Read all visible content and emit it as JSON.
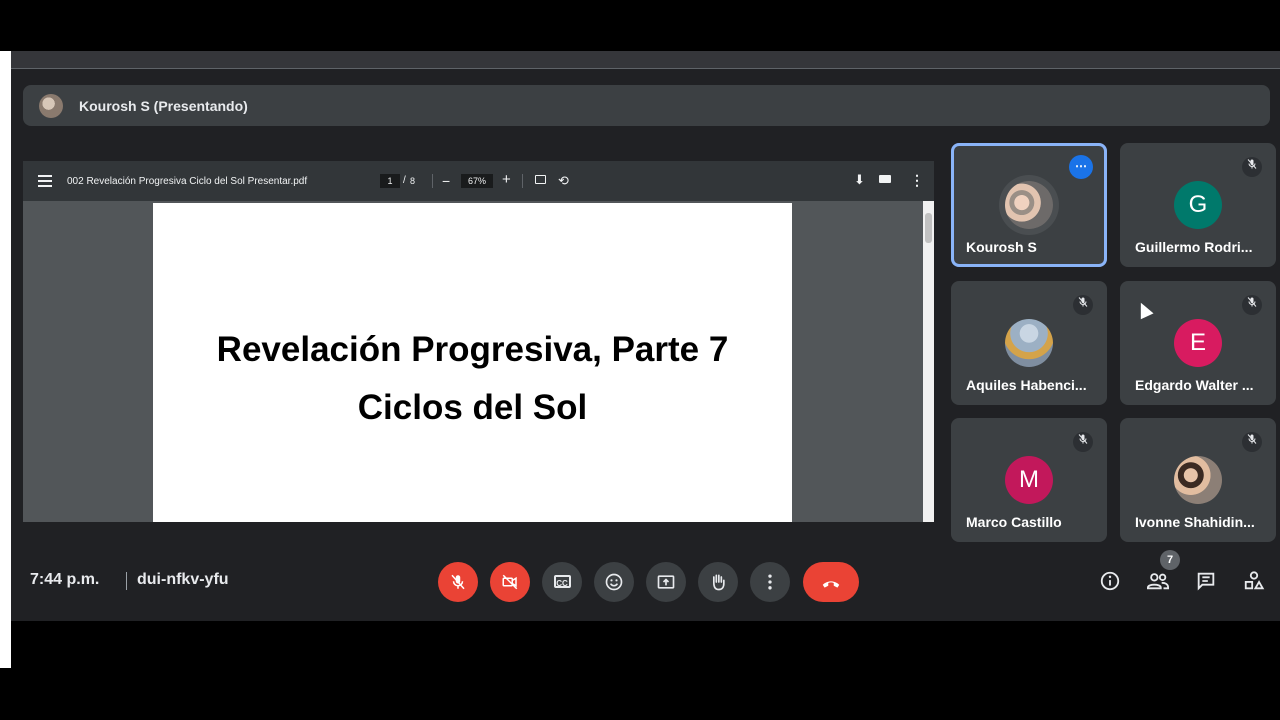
{
  "presenter": {
    "name": "Kourosh S (Presentando)"
  },
  "pdf_viewer": {
    "filename": "002 Revelación Progresiva Ciclo del Sol Presentar.pdf",
    "page_current": "1",
    "page_separator": "/",
    "page_total": "8",
    "zoom": "67%",
    "zoom_out_glyph": "−",
    "zoom_in_glyph": "+",
    "rotate_glyph": "⟲",
    "download_glyph": "⬇",
    "more_glyph": "⋮",
    "slide": {
      "line1": "Revelación Progresiva, Parte 7",
      "line2": "Ciclos del Sol"
    }
  },
  "participants": [
    {
      "name": "Kourosh S",
      "avatar_type": "photo",
      "active": true
    },
    {
      "name": "Guillermo Rodri...",
      "initial": "G",
      "color": "#00796b",
      "muted": true
    },
    {
      "name": "Aquiles Habenci...",
      "avatar_type": "photo",
      "muted": true
    },
    {
      "name": "Edgardo Walter ...",
      "initial": "E",
      "color": "#d81b60",
      "muted": true
    },
    {
      "name": "Marco Castillo",
      "initial": "M",
      "color": "#c2185b",
      "muted": true
    },
    {
      "name": "Ivonne Shahidin...",
      "avatar_type": "photo",
      "muted": true
    }
  ],
  "bottom_bar": {
    "time": "7:44 p.m.",
    "meeting_code": "dui-nfkv-yfu",
    "people_count": "7",
    "cc_label": "CC",
    "options_glyph": "⋯"
  },
  "icons": {
    "mic_off": "mic-off-icon",
    "camera_off": "camera-off-icon",
    "captions": "captions-icon",
    "emoji": "emoji-icon",
    "present": "present-screen-icon",
    "hand": "raise-hand-icon",
    "more": "more-options-icon",
    "end_call": "end-call-icon",
    "info": "info-icon",
    "people": "people-icon",
    "chat": "chat-icon",
    "activities": "activities-icon"
  },
  "colors": {
    "accent": "#8ab4f8",
    "danger": "#ea4335",
    "surface": "#3c4043",
    "background": "#202124"
  }
}
